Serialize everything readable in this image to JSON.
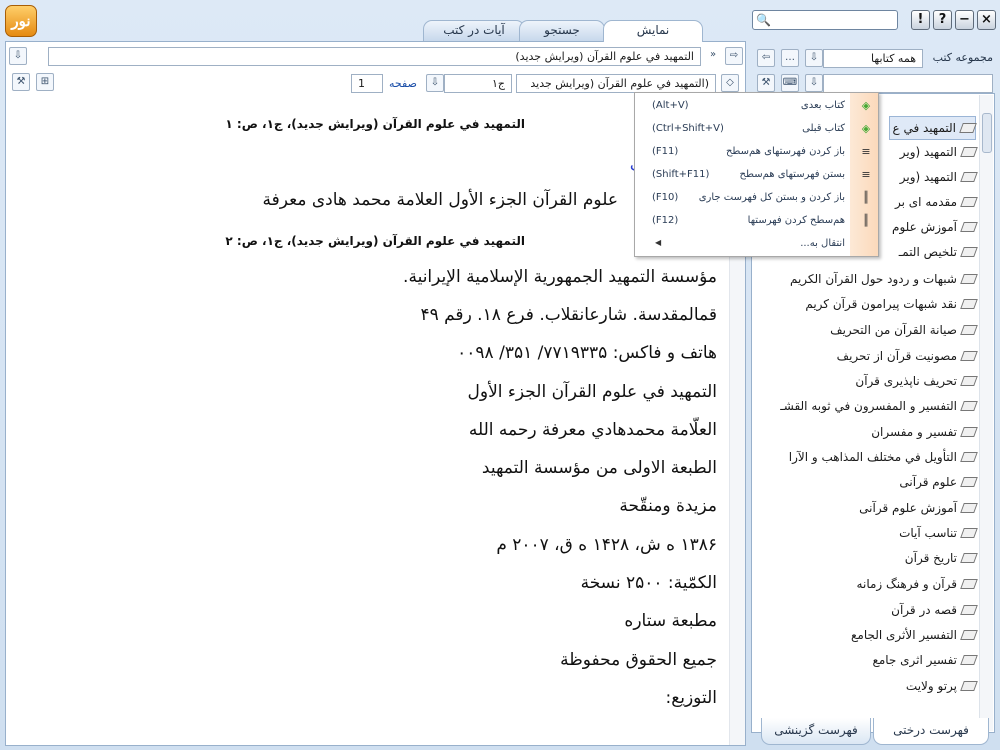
{
  "app": {
    "logo_text": "نور"
  },
  "tabs": [
    {
      "label": "نمایش"
    },
    {
      "label": "جستجو"
    },
    {
      "label": "آیات در کتب"
    }
  ],
  "window_controls": {
    "close": "×",
    "minimize": "−",
    "help": "?",
    "info": "!"
  },
  "toolbar": {
    "book_title": "التمهيد في علوم القرآن (ويرايش جديد)",
    "volume_select": "(التمهيد في علوم القرآن (ويرايش جديد",
    "volume_num": "ج۱",
    "page_label": "صفحه",
    "page_value": "1"
  },
  "document": {
    "page_header_1": "التمهيد في علوم القرآن (ويرايش جديد)، ج‏۱، ص: ۱",
    "page_header_2": "التمهيد في علوم القرآن (ويرايش جديد)، ج‏۱، ص: ۲",
    "fragment": "ل",
    "lines": [
      "علوم القرآن الجزء الأول العلامة محمد هادى معرفة",
      "مؤسسة التمهيد الجمهورية الإسلامية الإيرانية.",
      "قم‏المقدسة. شارع‏انقلاب. فرع ۱۸. رقم ۴۹",
      "هاتف و فاكس: ۷۷۱۹۳۳۵/ ۳۵۱/ ۰۰۹۸",
      "التمهيد في علوم القرآن الجزء الأول",
      "العلّامة محمدهادي معرفة رحمه الله",
      "الطبعة الاولى من مؤسسة التمهيد",
      "مزيدة ومنقّحة",
      "۱۳۸۶ ه ش، ۱۴۲۸ ه ق، ۲۰۰۷ م",
      "الكمّية: ۲۵۰۰ نسخة",
      "مطبعة ستاره",
      "جميع الحقوق محفوظة",
      "التوزيع:"
    ]
  },
  "right_panel": {
    "label": "مجموعه کتب",
    "collection_select": "همه کتابها",
    "books": [
      "التمهيد في ع",
      "التمهيد (وير",
      "التمهيد (وير",
      "مقدمه ای بر",
      "آموزش علوم",
      "تلخيص التمـ",
      "شبهات و ردود حول القرآن الكريم",
      "نقد شبهات پيرامون قرآن كريم",
      "صيانة القرآن من التحريف",
      "مصونيت قرآن از تحريف",
      "تحريف ناپذيرى قرآن",
      "التفسير و المفسرون في ثوبه القشـ",
      "تفسير و مفسران",
      "التأويل في مختلف المذاهب و الآرا",
      "علوم قرآنى",
      "آموزش علوم قرآنى",
      "تناسب آيات",
      "تاريخ قرآن",
      "قرآن و فرهنگ زمانه",
      "قصه در قرآن",
      "التفسير الأثرى الجامع",
      "تفسير اثرى جامع",
      "پرتو ولايت"
    ],
    "bottom_tabs": [
      {
        "label": "فهرست درختی"
      },
      {
        "label": "فهرست گزینشی"
      }
    ]
  },
  "context_menu": {
    "items": [
      {
        "label": "کتاب بعدی",
        "shortcut": "(Alt+V)"
      },
      {
        "label": "کتاب قبلی",
        "shortcut": "(Ctrl+Shift+V)"
      },
      {
        "label": "باز کردن فهرستهای هم‌سطح",
        "shortcut": "(F11)"
      },
      {
        "label": "بستن فهرستهای هم‌سطح",
        "shortcut": "(Shift+F11)"
      },
      {
        "label": "باز کردن و بستن کل فهرست جاری",
        "shortcut": "(F10)"
      },
      {
        "label": "هم‌سطح کردن فهرستها",
        "shortcut": "(F12)"
      },
      {
        "label": "انتقال به...",
        "shortcut": ""
      }
    ]
  }
}
